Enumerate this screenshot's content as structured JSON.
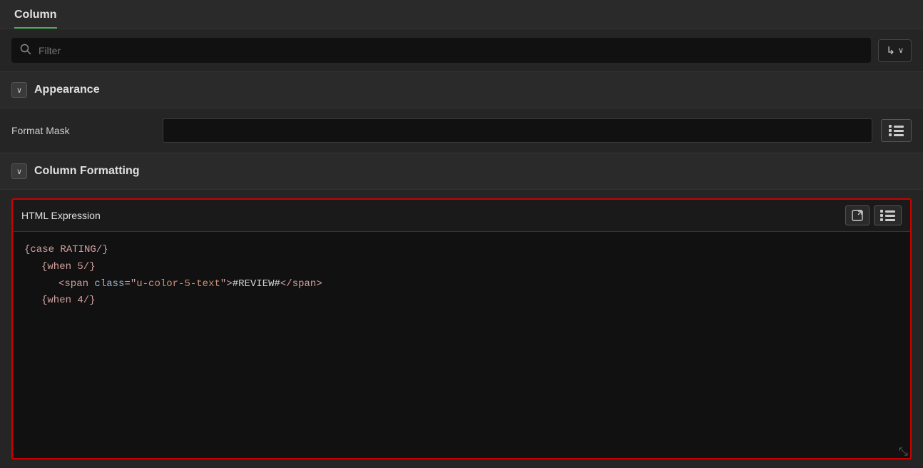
{
  "header": {
    "tab_label": "Column"
  },
  "filter": {
    "placeholder": "Filter",
    "sort_btn_label": "↳∨"
  },
  "appearance": {
    "section_title": "Appearance",
    "collapse_icon": "∨",
    "format_mask_label": "Format Mask",
    "format_mask_value": ""
  },
  "column_formatting": {
    "section_title": "Column Formatting",
    "collapse_icon": "∨",
    "html_expression": {
      "title": "HTML Expression",
      "code_lines": [
        "{case RATING/}",
        "    {when 5/}",
        "        <span class=\"u-color-5-text\">#REVIEW#</span>",
        "    {when 4/}"
      ]
    }
  },
  "icons": {
    "search": "🔍",
    "list": "☰",
    "expand": "⤢",
    "resize": "⤡"
  }
}
